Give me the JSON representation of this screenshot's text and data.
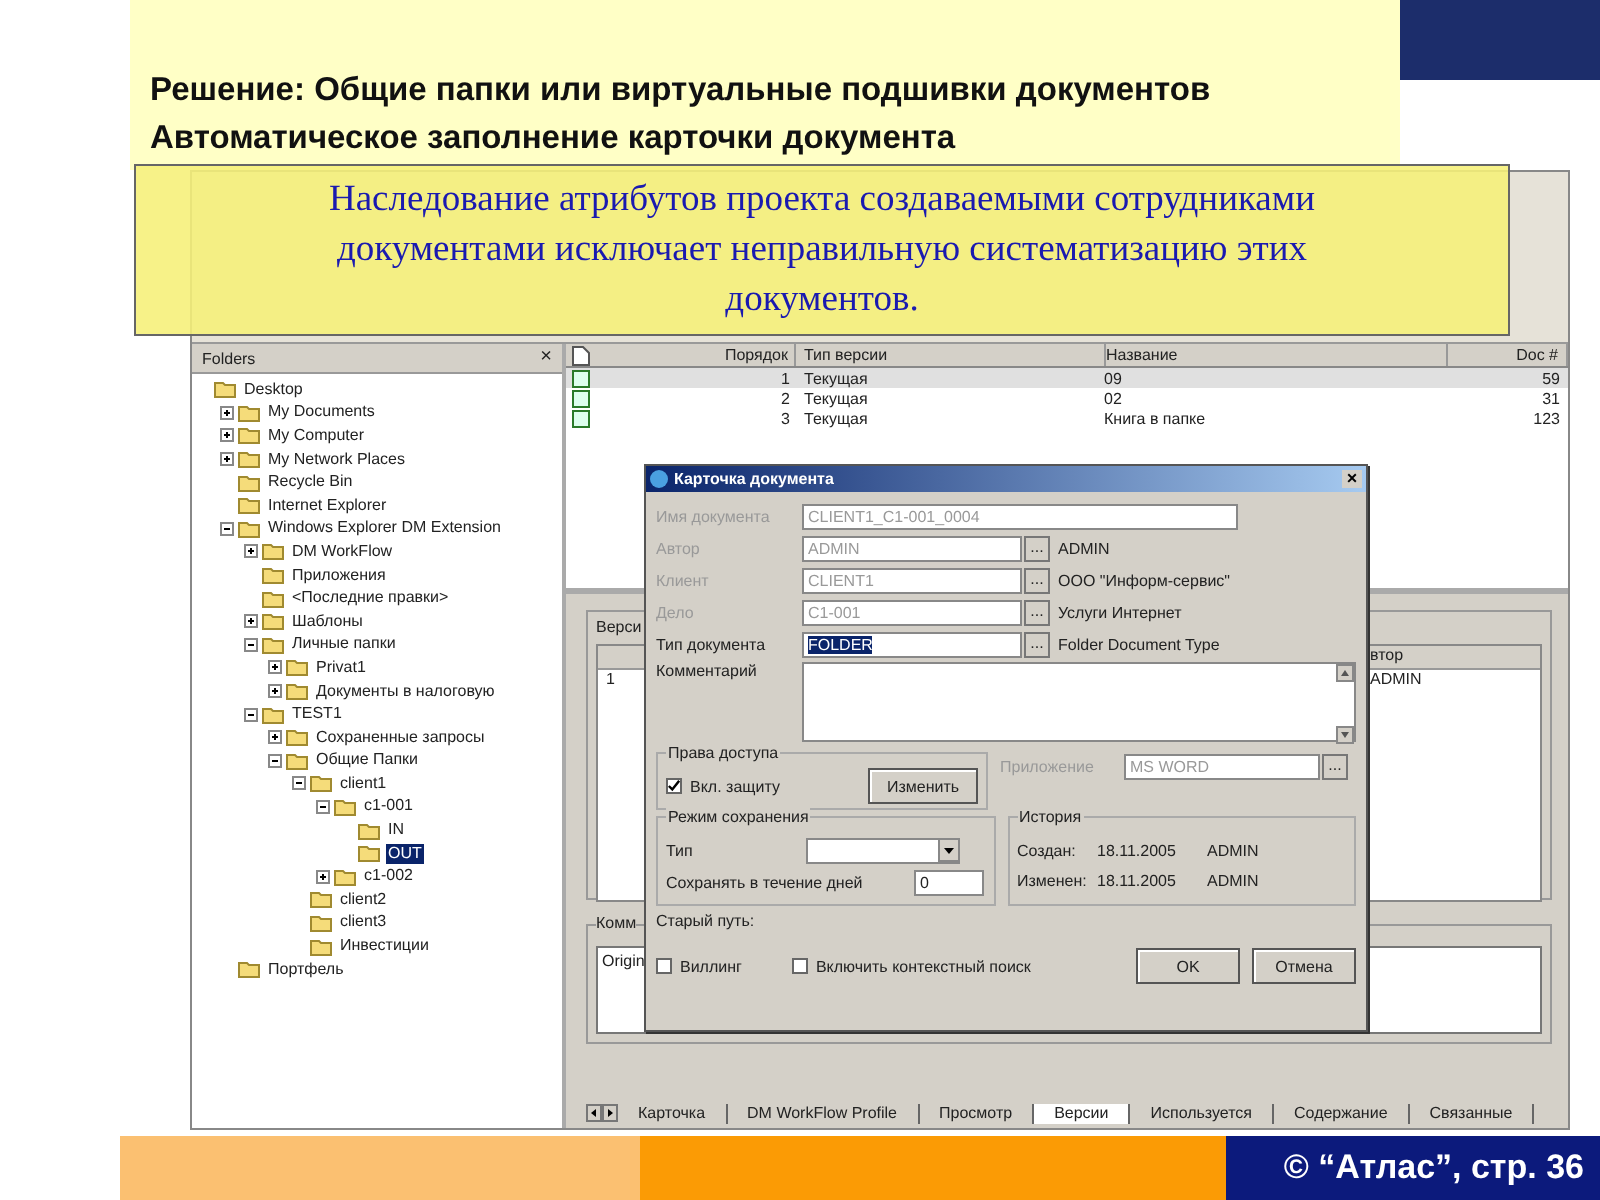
{
  "slide": {
    "title_lines": [
      "Решение: Общие папки или виртуальные подшивки документов",
      "Автоматическое заполнение карточки документа"
    ],
    "callout": "Наследование атрибутов проекта создаваемыми сотрудниками документами исключает неправильную систематизацию этих документов.",
    "footer": "© “Атлас”, стр. 36"
  },
  "folders_pane": {
    "title": "Folders",
    "close": "×",
    "tree": [
      {
        "label": "Desktop",
        "selected": false,
        "children": [
          {
            "label": "My Documents",
            "expanded": false,
            "selected": false
          },
          {
            "label": "My Computer",
            "expanded": false,
            "selected": false
          },
          {
            "label": "My Network Places",
            "expanded": false,
            "selected": false
          },
          {
            "label": "Recycle Bin",
            "selected": false
          },
          {
            "label": "Internet Explorer",
            "selected": false
          },
          {
            "label": "Windows Explorer DM Extension",
            "expanded": true,
            "selected": false,
            "children": [
              {
                "label": "DM WorkFlow",
                "expanded": false,
                "selected": false
              },
              {
                "label": "Приложения",
                "selected": false
              },
              {
                "label": "<Последние правки>",
                "selected": false
              },
              {
                "label": "Шаблоны",
                "expanded": false,
                "selected": false
              },
              {
                "label": "Личные папки",
                "expanded": true,
                "selected": false,
                "children": [
                  {
                    "label": "Privat1",
                    "expanded": false,
                    "selected": false
                  },
                  {
                    "label": "Документы в налоговую",
                    "expanded": false,
                    "selected": false
                  }
                ]
              },
              {
                "label": "TEST1",
                "expanded": true,
                "selected": false,
                "children": [
                  {
                    "label": "Сохраненные запросы",
                    "expanded": false,
                    "selected": false
                  },
                  {
                    "label": "Общие Папки",
                    "expanded": true,
                    "selected": false,
                    "children": [
                      {
                        "label": "client1",
                        "expanded": true,
                        "selected": false,
                        "children": [
                          {
                            "label": "c1-001",
                            "expanded": true,
                            "selected": false,
                            "children": [
                              {
                                "label": "IN",
                                "selected": false
                              },
                              {
                                "label": "OUT",
                                "selected": true
                              }
                            ]
                          },
                          {
                            "label": "c1-002",
                            "expanded": false,
                            "selected": false
                          }
                        ]
                      },
                      {
                        "label": "client2",
                        "selected": false
                      },
                      {
                        "label": "client3",
                        "selected": false
                      },
                      {
                        "label": "Инвестиции",
                        "selected": false
                      }
                    ]
                  }
                ]
              }
            ]
          },
          {
            "label": "Портфель",
            "selected": false
          }
        ]
      }
    ]
  },
  "list": {
    "columns": [
      "Порядок",
      "Тип версии",
      "Название",
      "Doc #"
    ],
    "rows": [
      {
        "order": "1",
        "type": "Текущая",
        "name": "09",
        "doc": "59",
        "selected": true
      },
      {
        "order": "2",
        "type": "Текущая",
        "name": "02",
        "doc": "31",
        "selected": false
      },
      {
        "order": "3",
        "type": "Текущая",
        "name": "Книга в папке",
        "doc": "123",
        "selected": false
      }
    ]
  },
  "lower_pane": {
    "versions_label": "Верси",
    "row_number": "1",
    "column": "втор",
    "cell": "ADMIN",
    "comment_label": "Комм",
    "comment_value": "Origin"
  },
  "tabs": [
    {
      "label": "Карточка",
      "selected": false
    },
    {
      "label": "DM WorkFlow Profile",
      "selected": false
    },
    {
      "label": "Просмотр",
      "selected": false
    },
    {
      "label": "Версии",
      "selected": true
    },
    {
      "label": "Используется",
      "selected": false
    },
    {
      "label": "Содержание",
      "selected": false
    },
    {
      "label": "Связанные",
      "selected": false
    }
  ],
  "dialog": {
    "title": "Карточка документа",
    "close": "×",
    "fields": [
      {
        "label": "Имя документа",
        "value": "CLIENT1_C1-001_0004",
        "disabled": true,
        "highlighted": false
      },
      {
        "label": "Автор",
        "value": "ADMIN",
        "disabled": true,
        "highlighted": false,
        "browse": "...",
        "description": "ADMIN"
      },
      {
        "label": "Клиент",
        "value": "CLIENT1",
        "disabled": true,
        "highlighted": false,
        "browse": "...",
        "description": "ООО \"Информ-сервис\""
      },
      {
        "label": "Дело",
        "value": "C1-001",
        "disabled": true,
        "highlighted": false,
        "browse": "...",
        "description": "Услуги Интернет"
      },
      {
        "label": "Тип документа",
        "value": "FOLDER",
        "disabled": false,
        "highlighted": true,
        "browse": "...",
        "description": "Folder Document Type"
      }
    ],
    "comment_label": "Комментарий",
    "access": {
      "title": "Права доступа",
      "checkbox": {
        "label": "Вкл. защиту",
        "checked": true
      },
      "button": "Изменить"
    },
    "application": {
      "label": "Приложение",
      "value": "MS WORD",
      "disabled": true,
      "browse": "..."
    },
    "save_mode": {
      "title": "Режим сохранения",
      "type_label": "Тип",
      "days_label": "Сохранять в течение дней",
      "days_value": "0"
    },
    "history": {
      "title": "История",
      "rows": [
        {
          "label": "Создан:",
          "date": "18.11.2005",
          "user": "ADMIN"
        },
        {
          "label": "Изменен:",
          "date": "18.11.2005",
          "user": "ADMIN"
        }
      ]
    },
    "old_path_label": "Старый путь:",
    "options": [
      {
        "label": "Виллинг",
        "checked": false
      },
      {
        "label": "Включить контекстный поиск",
        "checked": false
      }
    ],
    "buttons": [
      "OK",
      "Отмена"
    ]
  }
}
